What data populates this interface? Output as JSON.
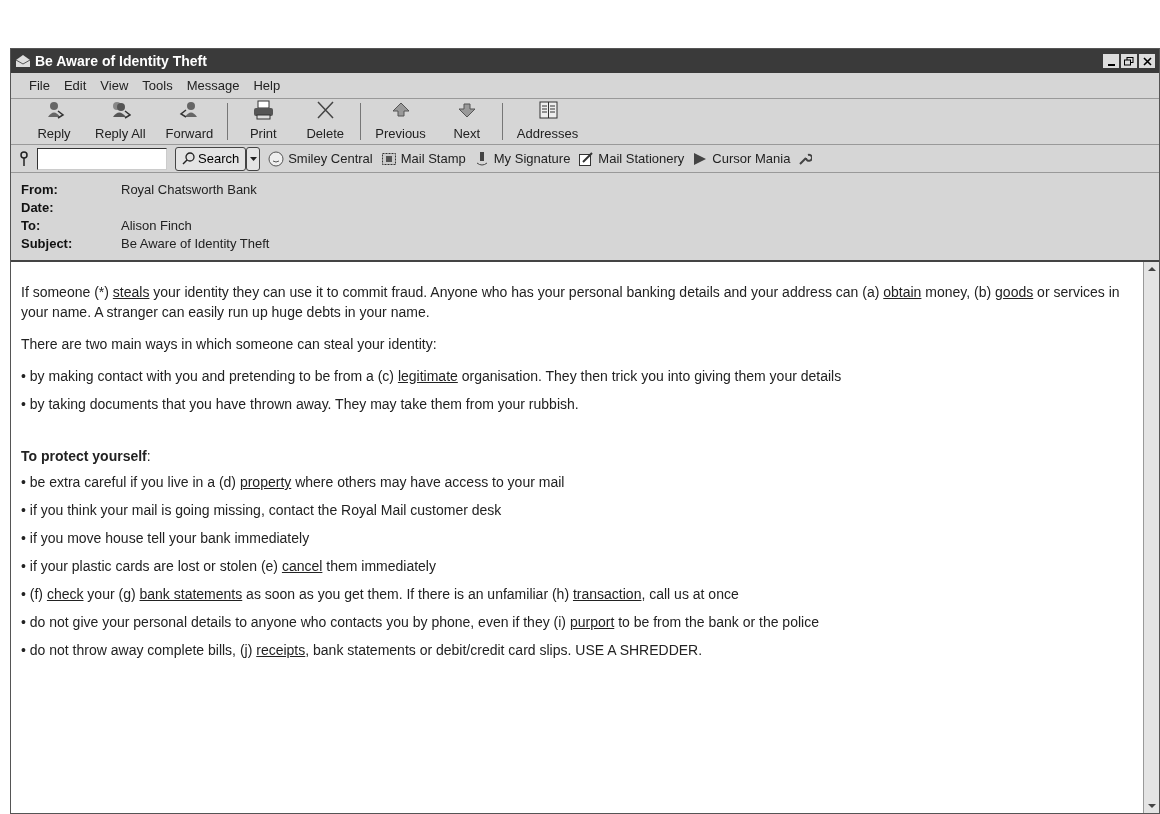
{
  "window": {
    "title": "Be Aware of Identity Theft"
  },
  "menu": [
    "File",
    "Edit",
    "View",
    "Tools",
    "Message",
    "Help"
  ],
  "toolbar": [
    {
      "label": "Reply",
      "kind": "reply"
    },
    {
      "label": "Reply All",
      "kind": "replyall"
    },
    {
      "label": "Forward",
      "kind": "forward",
      "group_end": true
    },
    {
      "label": "Print",
      "kind": "print"
    },
    {
      "label": "Delete",
      "kind": "delete",
      "group_end": true
    },
    {
      "label": "Previous",
      "kind": "up"
    },
    {
      "label": "Next",
      "kind": "down",
      "group_end": true
    },
    {
      "label": "Addresses",
      "kind": "book"
    }
  ],
  "search_bar": {
    "button": "Search",
    "links": [
      {
        "label": "Smiley Central",
        "kind": "smiley"
      },
      {
        "label": "Mail Stamp",
        "kind": "stamp"
      },
      {
        "label": "My Signature",
        "kind": "pen"
      },
      {
        "label": "Mail Stationery",
        "kind": "pad"
      },
      {
        "label": "Cursor Mania",
        "kind": "cursor"
      }
    ]
  },
  "headers": [
    {
      "label": "From:",
      "value": "Royal Chatsworth Bank"
    },
    {
      "label": "Date:"
    },
    {
      "label": "To:",
      "value": "Alison Finch"
    },
    {
      "label": "Subject:",
      "value": "Be Aware of Identity Theft"
    }
  ],
  "body": [
    {
      "kind": "paragraph",
      "parts": [
        {
          "text": "If someone (*) "
        },
        {
          "text": "steals",
          "underlined": true
        },
        {
          "text": " your identity they can use it to commit fraud. Anyone who has your personal banking details and your address can (a) "
        },
        {
          "text": "obtain",
          "underlined": true
        },
        {
          "text": " money, (b) "
        },
        {
          "text": "goods",
          "underlined": true
        },
        {
          "text": " or services in your name. A stranger can easily run up huge debts in your name."
        }
      ]
    },
    {
      "kind": "paragraph",
      "parts": [
        {
          "text": "There are two main ways in which someone can steal your identity:"
        }
      ]
    },
    {
      "kind": "bullet",
      "marker": "•",
      "parts": [
        {
          "text": "by making contact with you and pretending to be from a (c) "
        },
        {
          "text": "legitimate",
          "underlined": true
        },
        {
          "text": " organisation. They then trick you into giving them your details"
        }
      ]
    },
    {
      "kind": "bullet",
      "marker": "•",
      "parts": [
        {
          "text": "by taking documents that you have thrown away. They may take them from your rubbish."
        }
      ]
    },
    {
      "kind": "heading",
      "text": "**To protect yourself**:"
    },
    {
      "kind": "bullet",
      "marker": "•",
      "parts": [
        {
          "text": "be extra careful if you live in a (d) "
        },
        {
          "text": "property",
          "underlined": true
        },
        {
          "text": " where others may have access to your mail"
        }
      ]
    },
    {
      "kind": "bullet",
      "marker": "•",
      "parts": [
        {
          "text": "if you think your mail is going missing, contact the Royal Mail customer desk"
        }
      ]
    },
    {
      "kind": "bullet",
      "marker": "•",
      "parts": [
        {
          "text": "if you move house tell your bank immediately"
        }
      ]
    },
    {
      "kind": "bullet",
      "marker": "•",
      "parts": [
        {
          "text": "if your plastic cards are lost or stolen (e) "
        },
        {
          "text": "cancel",
          "underlined": true
        },
        {
          "text": " them immediately"
        }
      ]
    },
    {
      "kind": "bullet",
      "marker": "•",
      "parts": [
        {
          "text": "(f) "
        },
        {
          "text": "check",
          "underlined": true
        },
        {
          "text": " your (g) "
        },
        {
          "text": "bank statements",
          "underlined": true
        },
        {
          "text": " as soon as you get them. If there is an unfamiliar (h) "
        },
        {
          "text": "transaction",
          "underlined": true
        },
        {
          "text": ", call us at once"
        }
      ]
    },
    {
      "kind": "bullet",
      "marker": "•",
      "parts": [
        {
          "text": "do not give your personal details to anyone who contacts you by phone, even if they (i) "
        },
        {
          "text": "purport",
          "underlined": true
        },
        {
          "text": " to be from the bank or the police"
        }
      ]
    },
    {
      "kind": "bullet",
      "marker": "•",
      "parts": [
        {
          "text": "do not throw away complete bills, (j) "
        },
        {
          "text": "receipts",
          "underlined": true
        },
        {
          "text": ", bank statements or debit/credit card slips. USE A SHREDDER."
        }
      ]
    }
  ]
}
